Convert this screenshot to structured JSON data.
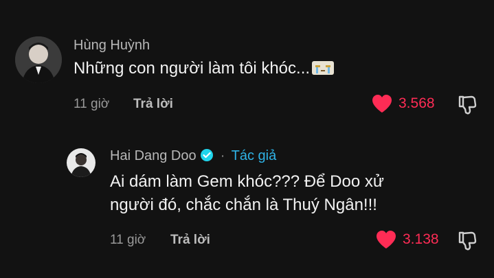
{
  "comments": [
    {
      "username": "Hùng Huỳnh",
      "text": "Những con người làm tôi khóc...",
      "emoji": "crying-emoji",
      "time": "11 giờ",
      "reply_label": "Trả lời",
      "likes": "3.568",
      "liked": true
    },
    {
      "username": "Hai Dang Doo",
      "verified": true,
      "separator": "·",
      "author_tag": "Tác giả",
      "text_line1": "Ai dám làm Gem khóc??? Để Doo xử",
      "text_line2": "người đó, chắc chắn là Thuý Ngân!!!",
      "time": "11 giờ",
      "reply_label": "Trả lời",
      "likes": "3.138",
      "liked": true
    }
  ],
  "colors": {
    "background": "#121212",
    "like_red": "#fe2c55",
    "author_blue": "#2fb3e6"
  }
}
